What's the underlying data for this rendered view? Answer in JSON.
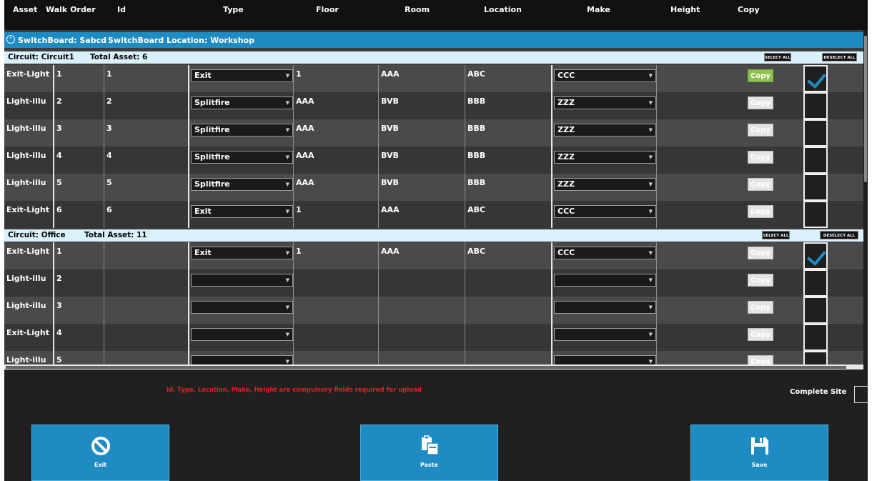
{
  "headers": [
    "Asset",
    "Walk Order",
    "Id",
    "Type",
    "Floor",
    "Room",
    "Location",
    "Make",
    "Height",
    "Copy"
  ],
  "switchboard": {
    "label": "SwitchBoard: Sabcd",
    "location": "SwitchBoard Location: Workshop"
  },
  "circuits": [
    {
      "name": "Circuit: Circuit1",
      "total": "Total Asset: 6",
      "select_all": "SELECT ALL",
      "deselect_all": "DESELECT ALL"
    },
    {
      "name": "Circuit: Office",
      "total": "Total Asset: 11",
      "select_all": "SELECT ALL",
      "deselect_all": "DESELECT ALL"
    }
  ],
  "rows": [
    {
      "asset": "Exit-Light",
      "walk": "1",
      "id": "1",
      "type": "Exit",
      "floor": "1",
      "room": "AAA",
      "location": "ABC",
      "make": "CCC",
      "copy": "Copy",
      "copy_active": true,
      "checked": true
    },
    {
      "asset": "Light-illu",
      "walk": "2",
      "id": "2",
      "type": "Splitfire",
      "floor": "AAA",
      "room": "BVB",
      "location": "BBB",
      "make": "ZZZ",
      "copy": "Copy",
      "copy_active": false,
      "checked": false
    },
    {
      "asset": "Light-illu",
      "walk": "3",
      "id": "3",
      "type": "Splitfire",
      "floor": "AAA",
      "room": "BVB",
      "location": "BBB",
      "make": "ZZZ",
      "copy": "Copy",
      "copy_active": false,
      "checked": false
    },
    {
      "asset": "Light-illu",
      "walk": "4",
      "id": "4",
      "type": "Splitfire",
      "floor": "AAA",
      "room": "BVB",
      "location": "BBB",
      "make": "ZZZ",
      "copy": "Copy",
      "copy_active": false,
      "checked": false
    },
    {
      "asset": "Light-illu",
      "walk": "5",
      "id": "5",
      "type": "Splitfire",
      "floor": "AAA",
      "room": "BVB",
      "location": "BBB",
      "make": "ZZZ",
      "copy": "Copy",
      "copy_active": false,
      "checked": false
    },
    {
      "asset": "Exit-Light",
      "walk": "6",
      "id": "6",
      "type": "Exit",
      "floor": "1",
      "room": "AAA",
      "location": "ABC",
      "make": "CCC",
      "copy": "Copy",
      "copy_active": false,
      "checked": false
    },
    {
      "asset": "Exit-Light",
      "walk": "1",
      "id": "",
      "type": "Exit",
      "floor": "1",
      "room": "AAA",
      "location": "ABC",
      "make": "CCC",
      "copy": "Copy",
      "copy_active": false,
      "checked": true
    },
    {
      "asset": "Light-illu",
      "walk": "2",
      "id": "",
      "type": "",
      "floor": "",
      "room": "",
      "location": "",
      "make": "",
      "copy": "Copy",
      "copy_active": false,
      "checked": false
    },
    {
      "asset": "Light-illu",
      "walk": "3",
      "id": "",
      "type": "",
      "floor": "",
      "room": "",
      "location": "",
      "make": "",
      "copy": "Copy",
      "copy_active": false,
      "checked": false
    },
    {
      "asset": "Exit-Light",
      "walk": "4",
      "id": "",
      "type": "",
      "floor": "",
      "room": "",
      "location": "",
      "make": "",
      "copy": "Copy",
      "copy_active": false,
      "checked": false
    },
    {
      "asset": "Light-illu",
      "walk": "5",
      "id": "",
      "type": "",
      "floor": "",
      "room": "",
      "location": "",
      "make": "",
      "copy": "Copy",
      "copy_active": false,
      "checked": false
    }
  ],
  "warning": "Id, Type, Location, Make, Height are compulsory fields required for upload",
  "complete_site": "Complete Site",
  "buttons": {
    "exit": "Exit",
    "paste": "Paste",
    "save": "Save"
  },
  "icons": {
    "exit": "prohibited-icon",
    "paste": "paste-icon",
    "save": "floppy-disk-icon",
    "collapse": "chevron-up-circle-icon",
    "dropdown": "triangle-down-icon",
    "check": "checkmark-icon"
  },
  "colors": {
    "accent": "#1e8bc3",
    "copy_active": "#8bc34a",
    "warning": "#e02020",
    "circuit_bar": "#d9f1fb"
  }
}
